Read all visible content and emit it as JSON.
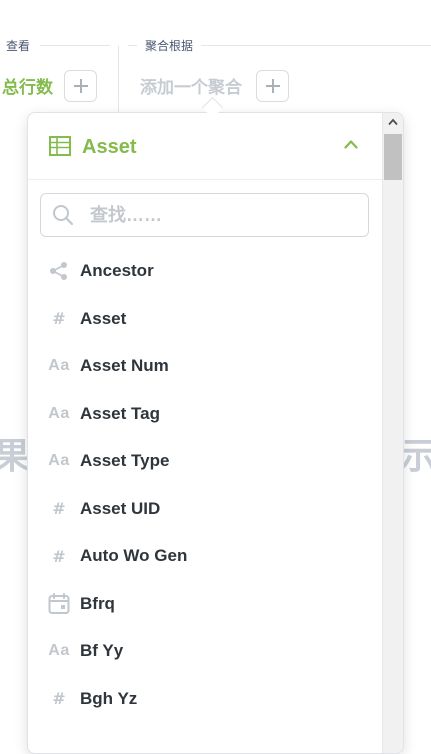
{
  "toolbar": {
    "view_label": "查看",
    "metric_label": "总行数",
    "group_label": "聚合根据",
    "group_placeholder": "添加一个聚合"
  },
  "background_text": {
    "left": "果信",
    "right": "示"
  },
  "popover": {
    "title": "Asset",
    "search_placeholder": "查找……",
    "fields": [
      {
        "icon": "share-icon",
        "label": "Ancestor"
      },
      {
        "icon": "hash-icon",
        "label": "Asset"
      },
      {
        "icon": "text-icon",
        "label": "Asset Num"
      },
      {
        "icon": "text-icon",
        "label": "Asset Tag"
      },
      {
        "icon": "text-icon",
        "label": "Asset Type"
      },
      {
        "icon": "hash-icon",
        "label": "Asset UID"
      },
      {
        "icon": "hash-icon",
        "label": "Auto Wo Gen"
      },
      {
        "icon": "calendar-icon",
        "label": "Bfrq"
      },
      {
        "icon": "text-icon",
        "label": "Bf Yy"
      },
      {
        "icon": "hash-icon",
        "label": "Bgh Yz"
      }
    ]
  },
  "colors": {
    "accent": "#84bb4c",
    "muted": "#c2c7cd",
    "text": "#2e353b"
  }
}
